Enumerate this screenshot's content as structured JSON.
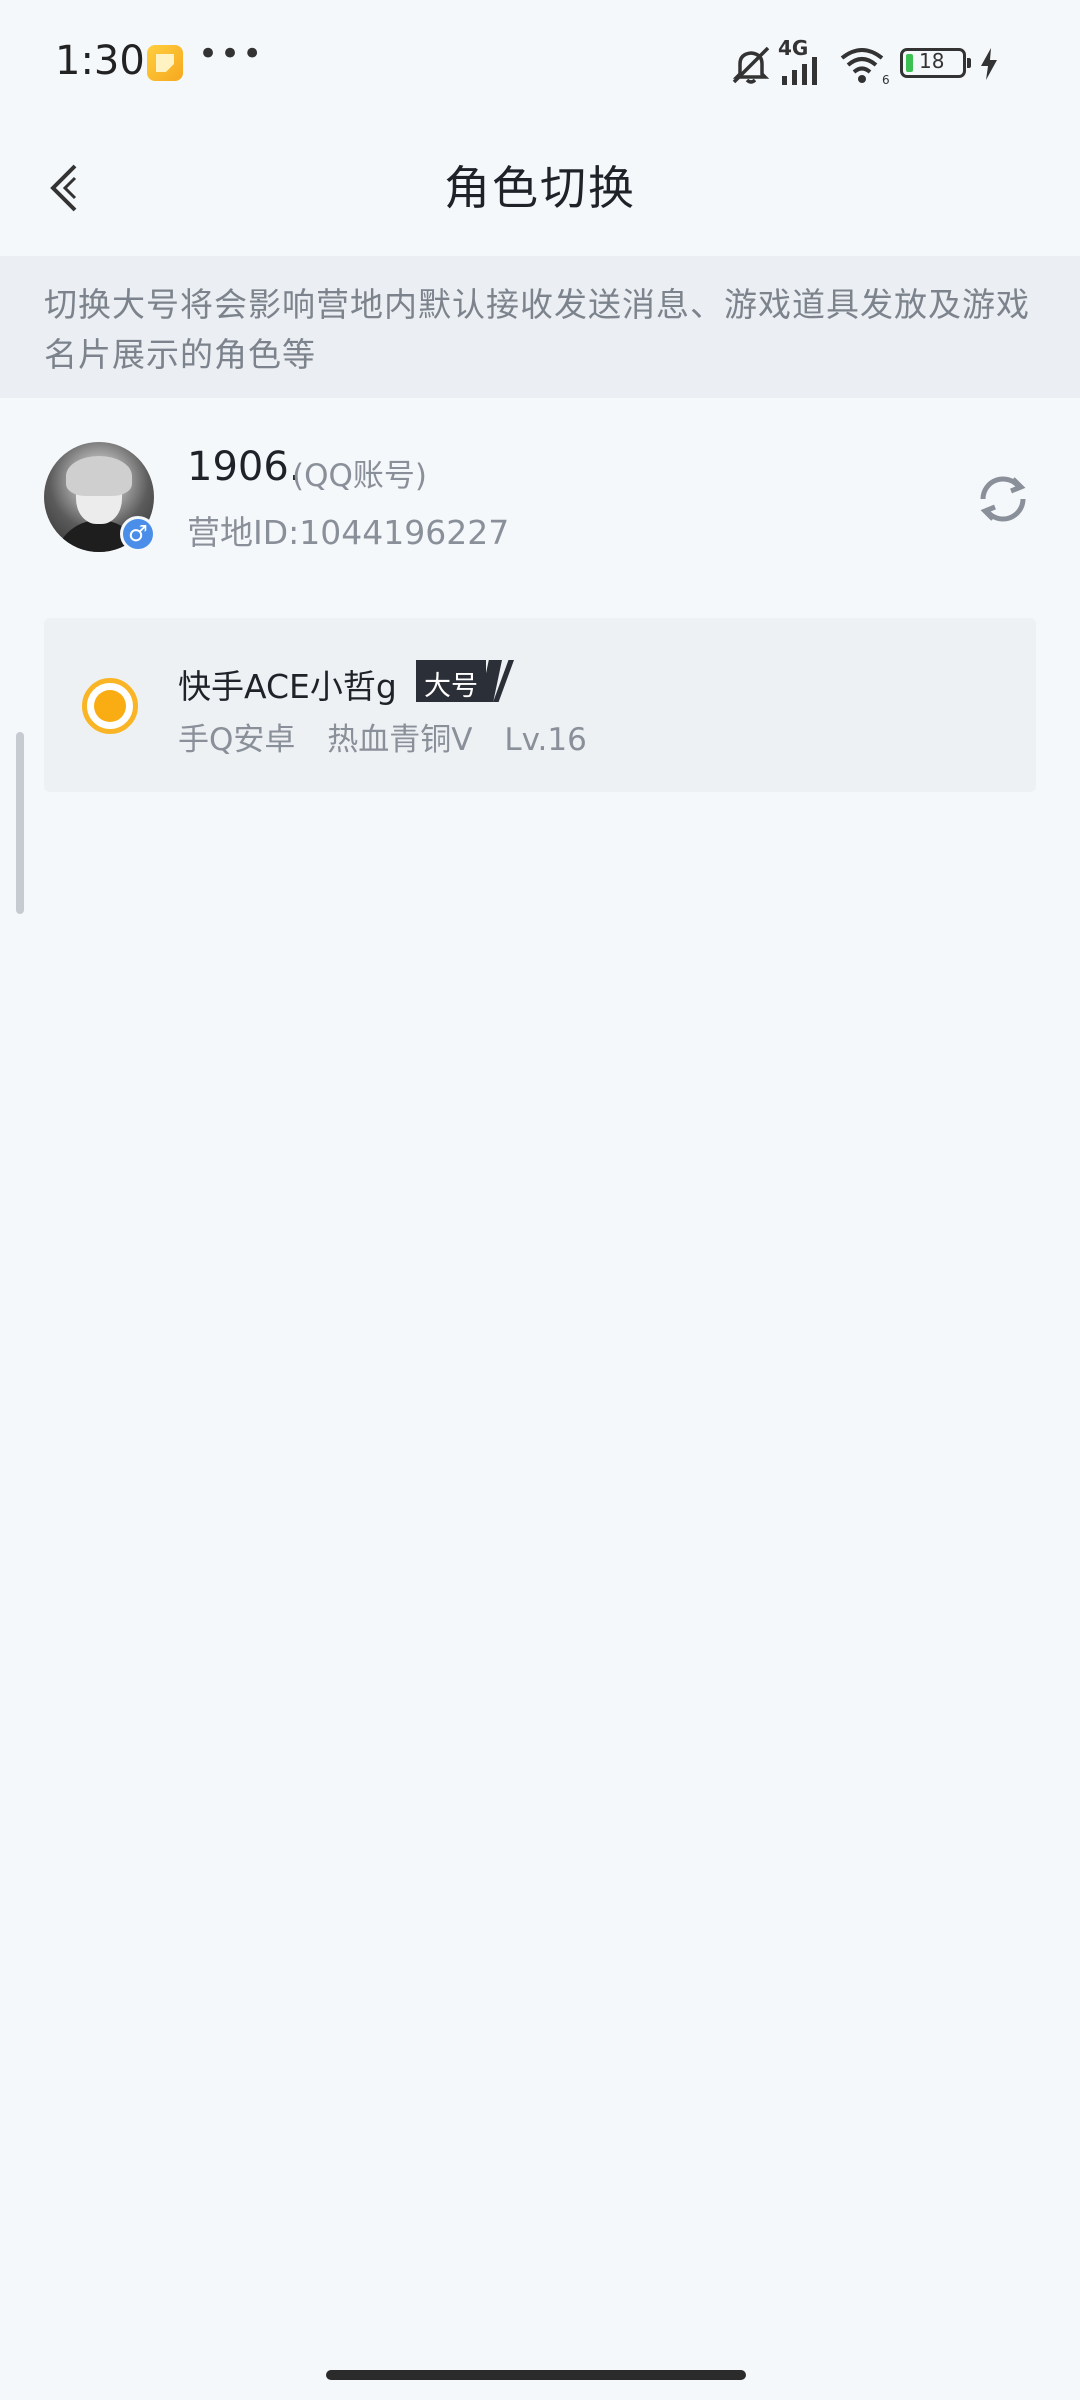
{
  "status_bar": {
    "time": "1:30",
    "dots": "•••",
    "network": "4G",
    "battery": "18",
    "icons": [
      "app-notification-icon",
      "mute-icon",
      "signal-icon",
      "wifi-icon",
      "battery-icon",
      "charging-icon"
    ]
  },
  "header": {
    "title": "角色切换",
    "back_icon": "chevron-left-icon"
  },
  "notice": {
    "text": "切换大号将会影响营地内默认接收发送消息、游戏道具发放及游戏名片展示的角色等"
  },
  "account": {
    "name": "1906.",
    "type": "(QQ账号)",
    "id_label": "营地ID:1044196227",
    "gender_icon": "male-icon",
    "refresh_icon": "refresh-icon"
  },
  "role": {
    "name": "快手ACE小哲g",
    "tag": "大号",
    "platform": "手Q安卓",
    "rank": "热血青铜V",
    "level": "Lv.16",
    "selected": true,
    "accent_color": "#f9ad12"
  }
}
